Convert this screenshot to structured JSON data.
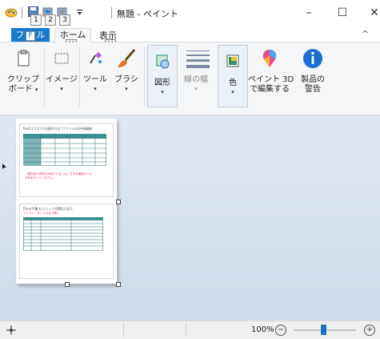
{
  "window": {
    "title": "無題 - ペイント",
    "minimize_glyph": "–",
    "maximize_glyph": "☐",
    "close_glyph": "✕"
  },
  "quick_access": {
    "keytips": [
      "1",
      "2",
      "3"
    ]
  },
  "tabs": {
    "file_label": "フ",
    "file_keytip": "F",
    "file_suffix": "ル",
    "home_label": "ホーム",
    "home_keytip": "H",
    "view_label": "表示",
    "view_keytip": "V",
    "collapse_glyph": "^"
  },
  "ribbon": {
    "clipboard": {
      "line1": "クリップ",
      "line2": "ボード",
      "arrow": "▾"
    },
    "image": {
      "line1": "イメージ",
      "arrow": "▾"
    },
    "tools": {
      "line1": "ツール",
      "arrow": "▾"
    },
    "brushes": {
      "line1": "ブラシ",
      "arrow": "▾"
    },
    "shapes": {
      "line1": "図形",
      "arrow": "▾"
    },
    "size": {
      "line1": "線の幅",
      "arrow": "▾"
    },
    "colors": {
      "line1": "色",
      "arrow": "▾"
    },
    "paint3d": {
      "line1": "ペイント 3D",
      "line2": "で編集する"
    },
    "product_alert": {
      "line1": "製品の",
      "line2": "警告"
    }
  },
  "canvas": {
    "sheet1_title": "Pad(スマホ)での操作方法 (ファイルの共有編集)",
    "sheet1_note1": "・閲覧者の状態を反映させるには、日付を確認のうえ",
    "sheet1_note2": "  共有を行ってください。",
    "sheet2_title": "Files(手書き)ミニッツ(閲覧方法2)",
    "sheet2_sub": "アイコン・タップのみで開く"
  },
  "status": {
    "zoom_level": "100%",
    "zoom_out_glyph": "−",
    "zoom_in_glyph": "+",
    "zoom_fraction": 0.5
  }
}
